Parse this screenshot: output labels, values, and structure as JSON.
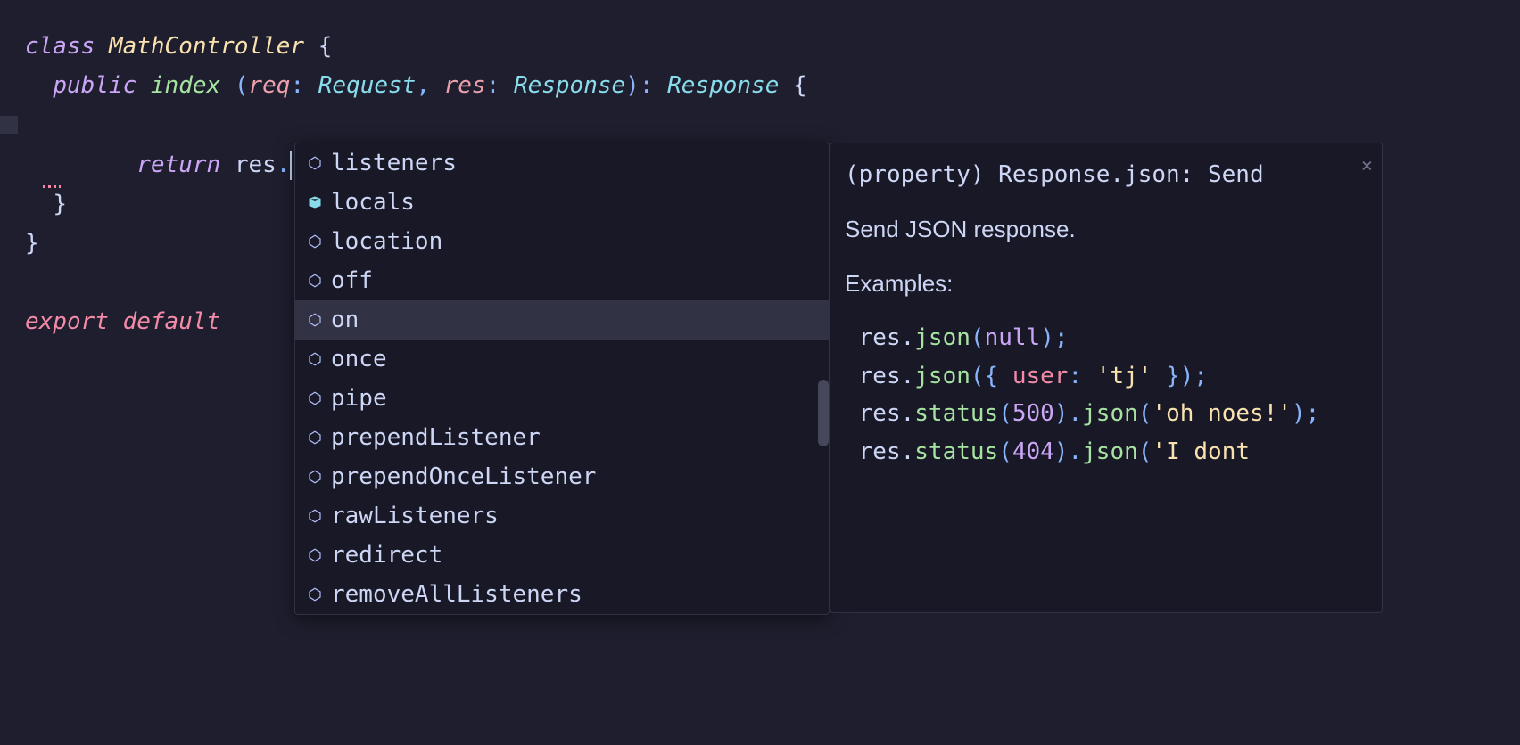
{
  "code": {
    "line1": {
      "class_kw": "class",
      "class_name": "MathController",
      "brace_open": "{"
    },
    "line2": {
      "public_kw": "public",
      "method": "index",
      "param1": "req",
      "type1": "Request",
      "param2": "res",
      "type2": "Response",
      "ret_type": "Response",
      "brace_open": "{"
    },
    "line3": {
      "return_kw": "return",
      "var": "res",
      "dot": "."
    },
    "line4": {
      "brace_close": "}"
    },
    "line5": {
      "brace_close": "}"
    },
    "line6": {
      "export_kw": "export",
      "default_kw": "default"
    }
  },
  "autocomplete": {
    "selected_index": 4,
    "items": [
      {
        "icon": "method",
        "label": "listeners"
      },
      {
        "icon": "property",
        "label": "locals"
      },
      {
        "icon": "method",
        "label": "location"
      },
      {
        "icon": "method",
        "label": "off"
      },
      {
        "icon": "method",
        "label": "on"
      },
      {
        "icon": "method",
        "label": "once"
      },
      {
        "icon": "method",
        "label": "pipe"
      },
      {
        "icon": "method",
        "label": "prependListener"
      },
      {
        "icon": "method",
        "label": "prependOnceListener"
      },
      {
        "icon": "method",
        "label": "rawListeners"
      },
      {
        "icon": "method",
        "label": "redirect"
      },
      {
        "icon": "method",
        "label": "removeAllListeners"
      }
    ]
  },
  "doc": {
    "signature": "(property) Response.json: Send",
    "description": "Send JSON response.",
    "examples_label": "Examples:",
    "examples": [
      {
        "prefix": " res.",
        "fn": "json",
        "open": "(",
        "args": [
          {
            "t": "null",
            "v": "null"
          }
        ],
        "close": ");"
      },
      {
        "prefix": " res.",
        "fn": "json",
        "open": "({ ",
        "args": [
          {
            "t": "key",
            "v": "user"
          },
          {
            "t": "punc",
            "v": ": "
          },
          {
            "t": "str",
            "v": "'tj'"
          }
        ],
        "close": " });"
      },
      {
        "prefix": " res.",
        "chain": [
          {
            "fn": "status",
            "open": "(",
            "args": [
              {
                "t": "num",
                "v": "500"
              }
            ],
            "close": ")"
          },
          {
            "dot": ".",
            "fn": "json",
            "open": "(",
            "args": [
              {
                "t": "str",
                "v": "'oh noes!'"
              }
            ],
            "close": ");"
          }
        ]
      },
      {
        "prefix": " res.",
        "chain": [
          {
            "fn": "status",
            "open": "(",
            "args": [
              {
                "t": "num",
                "v": "404"
              }
            ],
            "close": ")"
          },
          {
            "dot": ".",
            "fn": "json",
            "open": "(",
            "args": [
              {
                "t": "str",
                "v": "'I dont"
              }
            ],
            "close": ""
          }
        ]
      }
    ],
    "close_label": "×"
  }
}
